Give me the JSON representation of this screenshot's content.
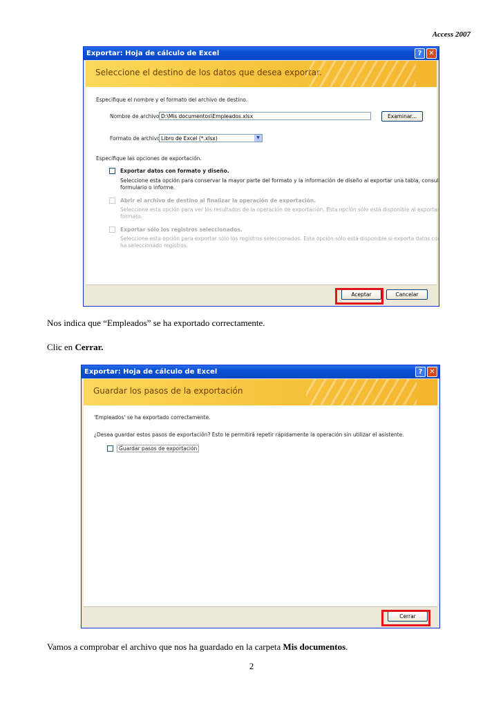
{
  "header": "Access 2007",
  "dialog1": {
    "title": "Exportar: Hoja de cálculo de Excel",
    "banner": "Seleccione el destino de los datos que desea exportar.",
    "intro": "Especifique el nombre y el formato del archivo de destino.",
    "filename_label": "Nombre de archivo:",
    "filename_value": "D:\\Mis documentos\\Empleados.xlsx",
    "browse_button": "Examinar...",
    "format_label": "Formato de archivo:",
    "format_value": "Libro de Excel (*.xlsx)",
    "options_intro": "Especifique las opciones de exportación.",
    "opt1_label": "Exportar datos con formato y diseño.",
    "opt1_desc1": "Seleccione esta opción para conservar la mayor parte del formato y la información de diseño al exportar una tabla, consulta,",
    "opt1_desc2": "formulario o informe.",
    "opt2_label": "Abrir el archivo de destino al finalizar la operación de exportación.",
    "opt2_desc1": "Seleccione esta opción para ver los resultados de la operación de exportación. Esta opción sólo está disponible al exportar datos con",
    "opt2_desc2": "formato.",
    "opt3_label": "Exportar sólo los registros seleccionados.",
    "opt3_desc1": "Seleccione esta opción para exportar sólo los registros seleccionados. Esta opción sólo está disponible si exporta datos con formato y",
    "opt3_desc2": "ha seleccionado registros.",
    "ok_button": "Aceptar",
    "cancel_button": "Cancelar"
  },
  "para1": "Nos indica que “Empleados” se ha exportado correctamente.",
  "para2_prefix": "Clic en ",
  "para2_bold": "Cerrar.",
  "dialog2": {
    "title": "Exportar: Hoja de cálculo de Excel",
    "banner": "Guardar los pasos de la exportación",
    "msg1": "'Empleados' se ha exportado correctamente.",
    "msg2": "¿Desea guardar estos pasos de exportación? Esto le permitirá repetir rápidamente la operación sin utilizar el asistente.",
    "save_steps_label": "Guardar pasos de exportación",
    "close_button": "Cerrar"
  },
  "para3_prefix": "Vamos a comprobar el archivo que nos ha guardado en la carpeta ",
  "para3_bold": "Mis documentos",
  "para3_suffix": ".",
  "page_number": "2"
}
